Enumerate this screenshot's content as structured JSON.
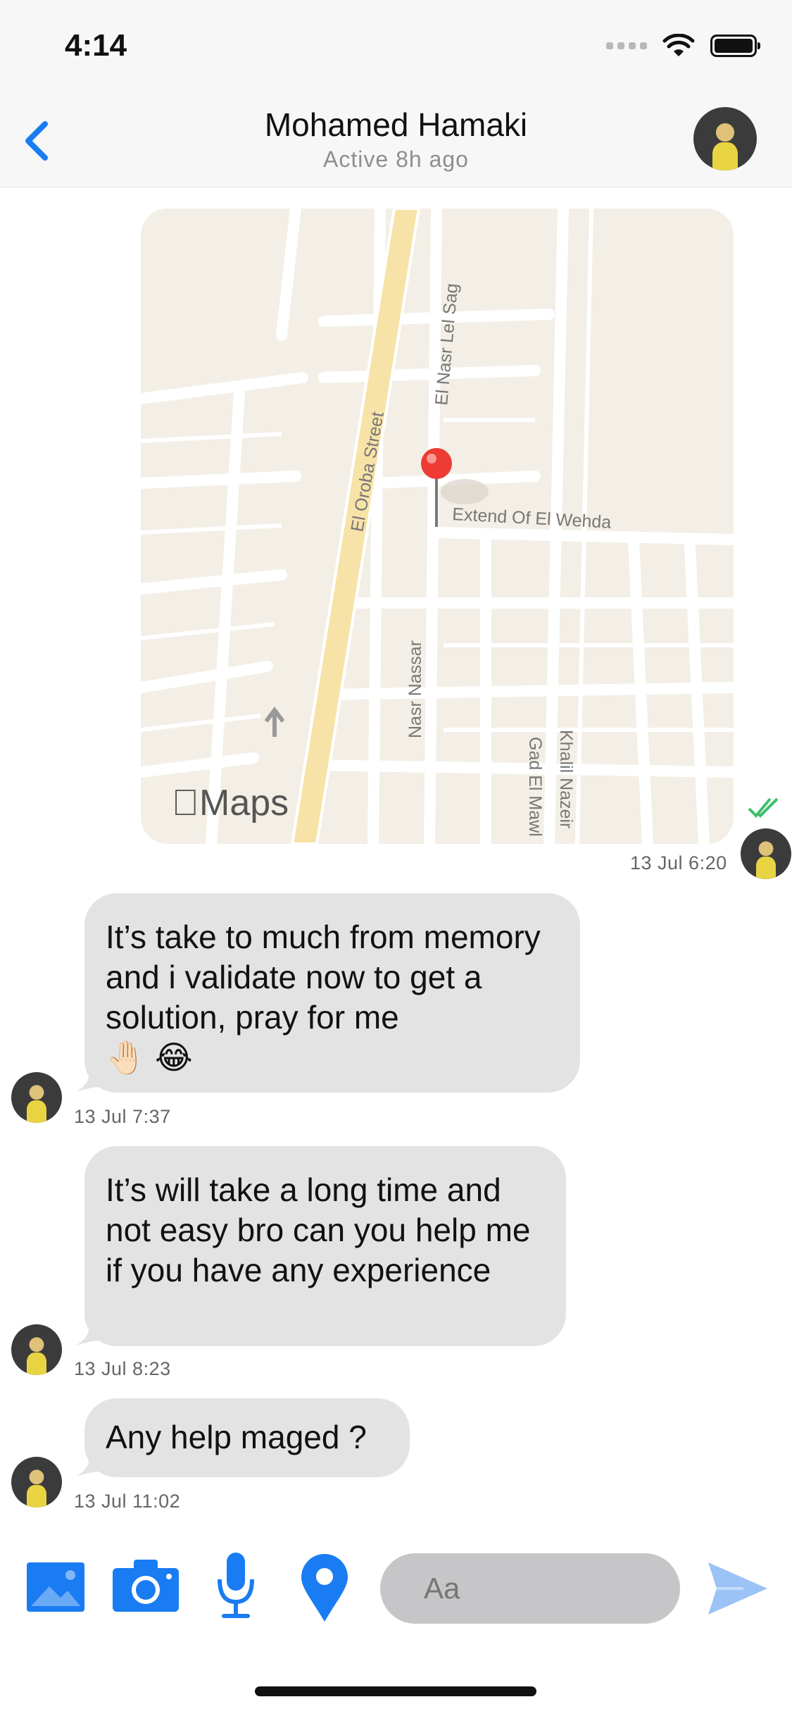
{
  "status_bar": {
    "time": "4:14"
  },
  "header": {
    "title": "Mohamed Hamaki",
    "subtitle": "Active 8h ago"
  },
  "map": {
    "logo": "Maps",
    "labels": [
      "El Oroba Street",
      "El Nasr Lel Sag",
      "Extend Of El Wehda",
      "Nasr Nassar",
      "Gad El Mawl",
      "Khalil Nazeir"
    ]
  },
  "messages": [
    {
      "type": "location",
      "time": "13 Jul 6:20"
    },
    {
      "type": "text",
      "text": "It’s take to much from memory and i validate now to get a solution, pray for me",
      "emoji": "🤚🏻 😂",
      "time": "13 Jul 7:37"
    },
    {
      "type": "text",
      "text": "It’s will take a long time and not easy bro can you help me if you have any experience",
      "time": "13 Jul 8:23"
    },
    {
      "type": "text",
      "text": "Any help maged ?",
      "time": "13 Jul 11:02"
    }
  ],
  "composer": {
    "placeholder": "Aa"
  },
  "colors": {
    "accent": "#1a7cf2",
    "bubble": "#e3e3e3",
    "read_tick": "#3fbf6a",
    "send_button": "#9cc3f5"
  },
  "icons": [
    "chevron-left-icon",
    "wifi-icon",
    "battery-icon",
    "photo-gallery-icon",
    "camera-icon",
    "microphone-icon",
    "location-pin-icon",
    "send-icon",
    "double-check-icon"
  ]
}
